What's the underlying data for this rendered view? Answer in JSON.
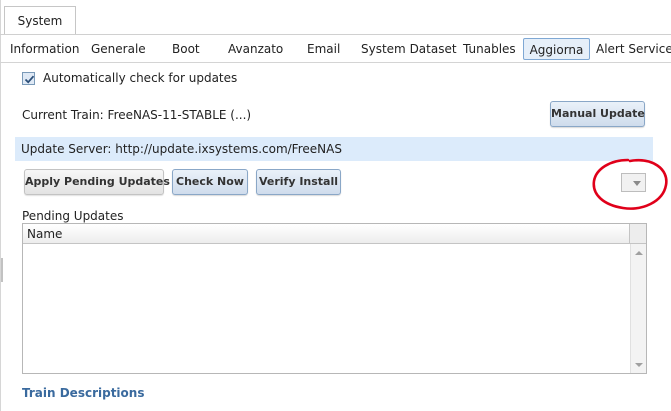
{
  "top_tab": {
    "label": "System"
  },
  "sub_tabs": [
    {
      "label": "Information"
    },
    {
      "label": "Generale"
    },
    {
      "label": "Boot"
    },
    {
      "label": "Avanzato"
    },
    {
      "label": "Email"
    },
    {
      "label": "System Dataset"
    },
    {
      "label": "Tunables"
    },
    {
      "label": "Aggiorna",
      "active": true
    },
    {
      "label": "Alert Services"
    }
  ],
  "auto_check": {
    "label": "Automatically check for updates",
    "checked": true
  },
  "current_train": "Current Train: FreeNAS-11-STABLE (...)",
  "buttons": {
    "manual_update": "Manual Update",
    "apply_pending": "Apply Pending Updates",
    "check_now": "Check Now",
    "verify_install": "Verify Install"
  },
  "update_server": "Update Server: http://update.ixsystems.com/FreeNAS",
  "pending": {
    "label": "Pending Updates",
    "columns": [
      "Name"
    ],
    "rows": []
  },
  "train_descriptions": "Train Descriptions",
  "colors": {
    "accent": "#3a6a9e",
    "server_bar": "#dcebfb",
    "annotation": "#e0001a"
  }
}
